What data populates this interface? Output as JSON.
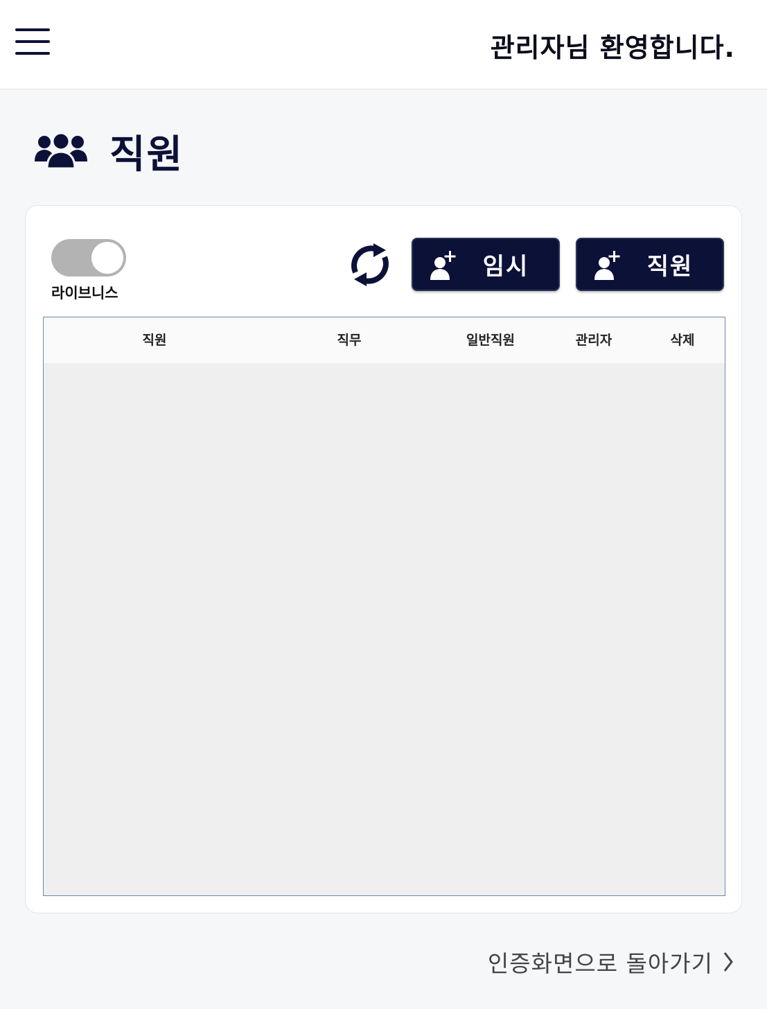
{
  "header": {
    "welcome_text": "관리자님 환영합니다."
  },
  "page": {
    "title": "직원",
    "title_icon": "team-icon"
  },
  "toolbar": {
    "toggle_label": "라이브니스",
    "toggle_on": false,
    "refresh_icon": "refresh-icon",
    "add_temp_label": "임시",
    "add_staff_label": "직원",
    "button_icon": "add-user-icon"
  },
  "table": {
    "columns": [
      "직원",
      "직무",
      "일반직원",
      "관리자",
      "삭제"
    ],
    "rows": []
  },
  "footer": {
    "back_link": "인증화면으로 돌아가기"
  },
  "colors": {
    "brand_navy": "#0c1138",
    "toggle_off": "#b3b3b3",
    "table_border": "#6d88a8",
    "table_body": "#efefef"
  }
}
